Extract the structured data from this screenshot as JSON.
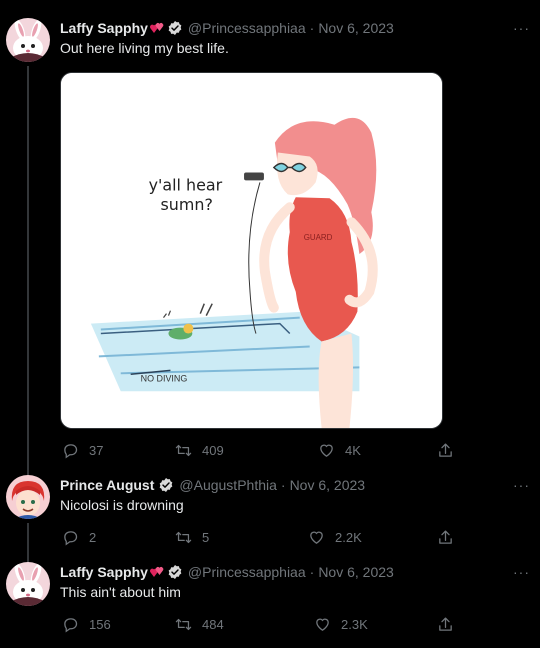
{
  "tweets": [
    {
      "name": "Laffy Sapphy",
      "handle": "@Princessapphiaa",
      "date": "Nov 6, 2023",
      "text": "Out here living my best life.",
      "replies": "37",
      "retweets": "409",
      "likes": "4K",
      "avatar_icon": "bunny-avatar",
      "image": {
        "caption_lines": [
          "y'all hear",
          "sumn?"
        ],
        "sign_text": "NO DIVING",
        "swimsuit_text": "GUARD"
      }
    },
    {
      "name": "Prince August",
      "handle": "@AugustPhthia",
      "date": "Nov 6, 2023",
      "text": "Nicolosi is drowning",
      "replies": "2",
      "retweets": "5",
      "likes": "2.2K",
      "avatar_icon": "red-hair-character-avatar"
    },
    {
      "name": "Laffy Sapphy",
      "handle": "@Princessapphiaa",
      "date": "Nov 6, 2023",
      "text": "This ain't about him",
      "replies": "156",
      "retweets": "484",
      "likes": "2.3K",
      "avatar_icon": "bunny-avatar"
    }
  ],
  "more_label": "···",
  "colors": {
    "background": "#000000",
    "text": "#e7e9ea",
    "muted": "#71767b",
    "verified": "#d9d9d9",
    "heart_emoji": "#e0245e"
  }
}
